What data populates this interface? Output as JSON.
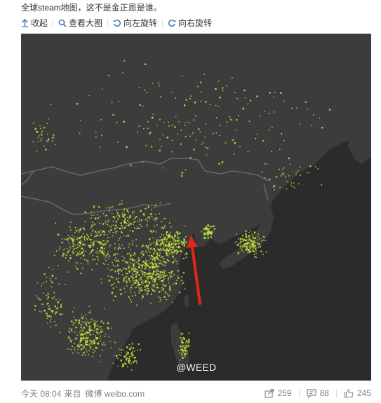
{
  "post": {
    "text": "全球steam地图，这不是金正恩是谁。"
  },
  "toolbar": {
    "collapse": "收起",
    "view_large": "查看大图",
    "rotate_left": "向左旋转",
    "rotate_right": "向右旋转"
  },
  "image": {
    "watermark": "@WEED"
  },
  "footer": {
    "time": "今天 08:04",
    "source_prefix": "来自",
    "source": "微博 weibo.com",
    "reposts": "259",
    "comments": "88",
    "likes": "245"
  },
  "colors": {
    "accent_link": "#2e6fb0",
    "map_sea": "#2b2b2b",
    "map_land": "#3c3c3c",
    "player_dots": "#c5e63a",
    "arrow": "#e0261d"
  }
}
